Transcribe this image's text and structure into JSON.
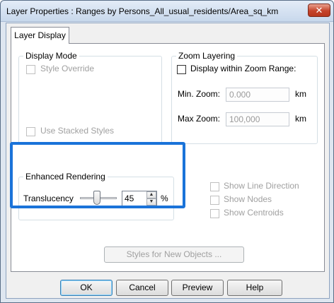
{
  "window": {
    "title": "Layer Properties : Ranges by Persons_All_usual_residents/Area_sq_km",
    "close_glyph": "✕"
  },
  "tabs": [
    {
      "label": "Layer Display",
      "selected": true
    }
  ],
  "display_mode": {
    "label": "Display Mode",
    "style_override": {
      "label": "Style Override",
      "checked": false,
      "enabled": false
    },
    "use_stacked_styles": {
      "label": "Use Stacked Styles",
      "checked": false,
      "enabled": false
    }
  },
  "zoom_layering": {
    "label": "Zoom Layering",
    "display_within_zoom": {
      "label": "Display within Zoom Range:",
      "checked": false,
      "enabled": true
    },
    "min_zoom": {
      "label": "Min. Zoom:",
      "value": "0.000",
      "unit": "km"
    },
    "max_zoom": {
      "label": "Max Zoom:",
      "value": "100,000",
      "unit": "km"
    }
  },
  "enhanced_rendering": {
    "label": "Enhanced Rendering",
    "translucency_label": "Translucency",
    "translucency_value": "45",
    "translucency_percent": 45,
    "unit": "%",
    "spin_up": "▲",
    "spin_down": "▼"
  },
  "display_options": {
    "show_line_direction": {
      "label": "Show Line Direction",
      "checked": false,
      "enabled": false
    },
    "show_nodes": {
      "label": "Show Nodes",
      "checked": false,
      "enabled": false
    },
    "show_centroids": {
      "label": "Show Centroids",
      "checked": false,
      "enabled": false
    }
  },
  "styles_button": {
    "label": "Styles for New Objects ..."
  },
  "footer": {
    "ok": "OK",
    "cancel": "Cancel",
    "preview": "Preview",
    "help": "Help"
  },
  "colors": {
    "highlight": "#1a73d9",
    "close_button": "#c5442b"
  }
}
